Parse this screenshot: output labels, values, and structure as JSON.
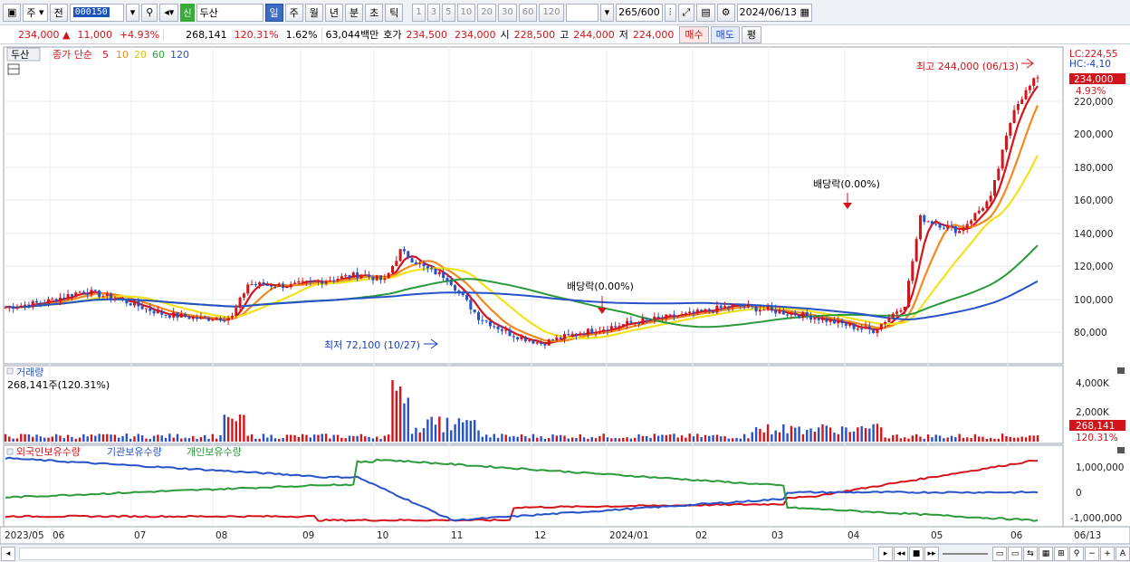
{
  "toolbar": {
    "market": "주",
    "prev": "전",
    "code": "000150",
    "name_tag": "신",
    "name": "두산",
    "periods": [
      "일",
      "주",
      "월",
      "년",
      "분",
      "초",
      "틱"
    ],
    "intervals": [
      "1",
      "3",
      "5",
      "10",
      "20",
      "30",
      "60",
      "120"
    ],
    "count": "265",
    "count_max": "/600",
    "date": "2024/06/13"
  },
  "quote": {
    "price": "234,000 ▲",
    "change": "11,000",
    "rate": "+4.93%",
    "volume": "268,141",
    "vol_rate": "120.31%",
    "turnover": "1.62%",
    "amount": "63,044백만",
    "ask_label": "호가",
    "ask1": "234,500",
    "ask2": "234,000",
    "open_label": "시",
    "open": "228,500",
    "high_label": "고",
    "high": "244,000",
    "low_label": "저",
    "low": "224,000",
    "buy": "매수",
    "sell": "매도",
    "avg": "평"
  },
  "price_panel": {
    "stock_tab": "두산",
    "legend_title": "종가 단순",
    "ma_periods": [
      "5",
      "10",
      "20",
      "60",
      "120"
    ],
    "ma_colors": [
      "#d3141a",
      "#f08a1e",
      "#f2e21c",
      "#2a9a3a",
      "#2752c7"
    ],
    "lc": "LC:224,55",
    "hc": "HC:-4,10",
    "last_price": "234,000",
    "last_rate": "4.93%",
    "high_annotation": "최고 244,000 (06/13)",
    "low_annotation": "최저 72,100 (10/27)",
    "dividend1": "배당락(0.00%)",
    "dividend2": "배당락(0.00%)",
    "y_ticks": [
      "220,000",
      "200,000",
      "180,000",
      "160,000",
      "140,000",
      "120,000",
      "100,000",
      "80,000"
    ]
  },
  "volume_panel": {
    "title": "거래량",
    "readout": "268,141주(120.31%)",
    "y_ticks": [
      "4,000K",
      "2,000K"
    ],
    "last_volume": "268,141",
    "last_rate": "120.31%"
  },
  "holding_panel": {
    "legend": [
      "외국인보유수량",
      "기관보유수량",
      "개인보유수량"
    ],
    "colors": [
      "#d3141a",
      "#2752c7",
      "#2a9a3a"
    ],
    "y_ticks": [
      "1,000,000",
      "0",
      "-1,000,000"
    ]
  },
  "x_axis": {
    "labels": [
      "2023/05",
      "06",
      "07",
      "08",
      "09",
      "10",
      "11",
      "12",
      "2024/01",
      "02",
      "03",
      "04",
      "05",
      "06"
    ],
    "last_label": "06/13"
  }
}
